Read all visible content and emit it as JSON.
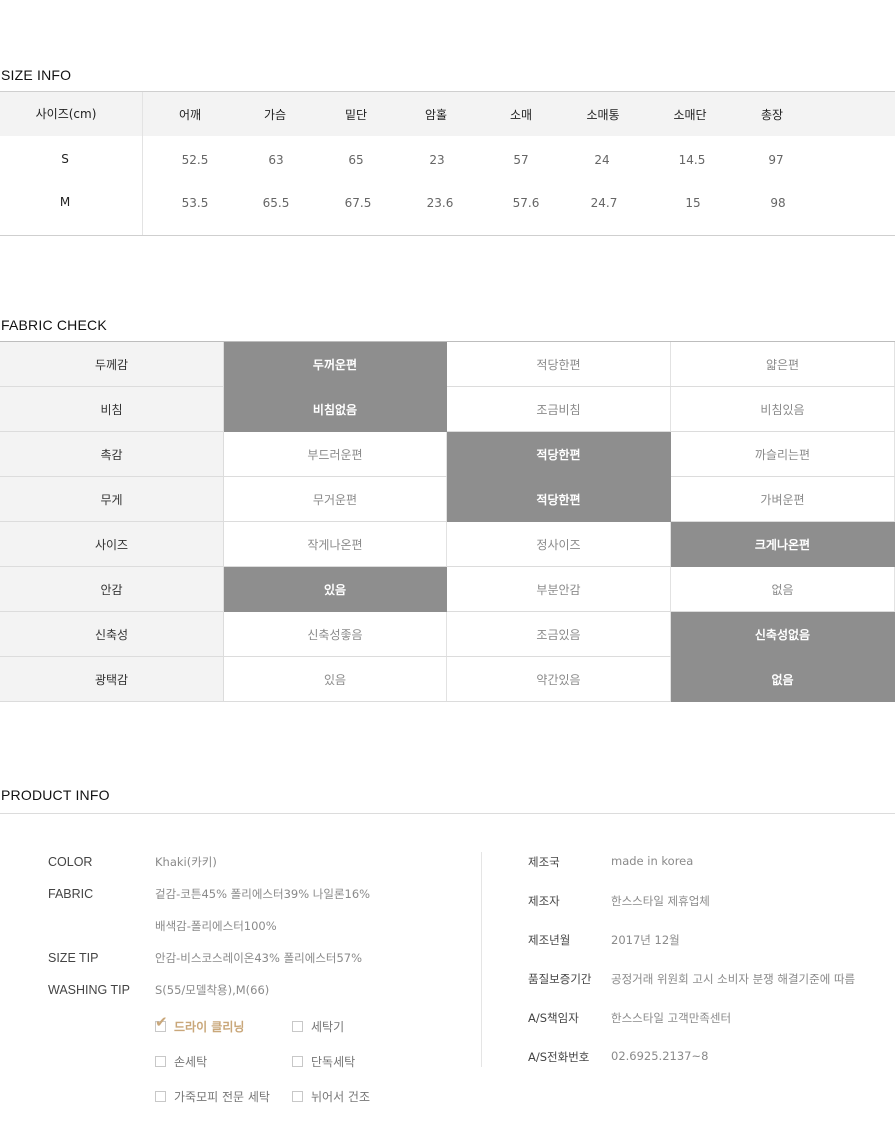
{
  "size_info": {
    "title": "SIZE INFO",
    "corner_label": "사이즈(cm)",
    "columns": [
      "어깨",
      "가슴",
      "밑단",
      "암홀",
      "소매",
      "소매통",
      "소매단",
      "총장"
    ],
    "rows": [
      {
        "size": "S",
        "values": [
          "52.5",
          "63",
          "65",
          "23",
          "57",
          "24",
          "14.5",
          "97"
        ]
      },
      {
        "size": "M",
        "values": [
          "53.5",
          "65.5",
          "67.5",
          "23.6",
          "57.6",
          "24.7",
          "15",
          "98"
        ]
      }
    ]
  },
  "fabric_check": {
    "title": "FABRIC CHECK",
    "rows": [
      {
        "label": "두께감",
        "options": [
          "두꺼운편",
          "적당한편",
          "얇은편"
        ],
        "selected": 0
      },
      {
        "label": "비침",
        "options": [
          "비침없음",
          "조금비침",
          "비침있음"
        ],
        "selected": 0
      },
      {
        "label": "촉감",
        "options": [
          "부드러운편",
          "적당한편",
          "까슬리는편"
        ],
        "selected": 1
      },
      {
        "label": "무게",
        "options": [
          "무거운편",
          "적당한편",
          "가벼운편"
        ],
        "selected": 1
      },
      {
        "label": "사이즈",
        "options": [
          "작게나온편",
          "정사이즈",
          "크게나온편"
        ],
        "selected": 2
      },
      {
        "label": "안감",
        "options": [
          "있음",
          "부분안감",
          "없음"
        ],
        "selected": 0
      },
      {
        "label": "신축성",
        "options": [
          "신축성좋음",
          "조금있음",
          "신축성없음"
        ],
        "selected": 2
      },
      {
        "label": "광택감",
        "options": [
          "있음",
          "약간있음",
          "없음"
        ],
        "selected": 2
      }
    ]
  },
  "product_info": {
    "title": "PRODUCT INFO",
    "left": {
      "color_label": "COLOR",
      "color_value": "Khaki(카키)",
      "fabric_label": "FABRIC",
      "fabric_lines": [
        "겉감-코튼45% 폴리에스터39% 나일론16%",
        "배색감-폴리에스터100%",
        "안감-비스코스레이온43% 폴리에스터57%"
      ],
      "size_tip_label": "SIZE TIP",
      "size_tip_value": "S(55/모델착용),M(66)",
      "washing_tip_label": "WASHING TIP",
      "washing_options": [
        {
          "label": "드라이 클리닝",
          "checked": true
        },
        {
          "label": "세탁기",
          "checked": false
        },
        {
          "label": "손세탁",
          "checked": false
        },
        {
          "label": "단독세탁",
          "checked": false
        },
        {
          "label": "가죽모피 전문 세탁",
          "checked": false
        },
        {
          "label": "뉘어서 건조",
          "checked": false
        }
      ]
    },
    "right": [
      {
        "label": "제조국",
        "value": "made in korea"
      },
      {
        "label": "제조자",
        "value": "한스스타일 제휴업체"
      },
      {
        "label": "제조년월",
        "value": "2017년 12월"
      },
      {
        "label": "품질보증기간",
        "value": "공정거래 위원회 고시 소비자 분쟁 해결기준에 따름"
      },
      {
        "label": "A/S책임자",
        "value": "한스스타일 고객만족센터"
      },
      {
        "label": "A/S전화번호",
        "value": "02.6925.2137~8"
      }
    ]
  }
}
